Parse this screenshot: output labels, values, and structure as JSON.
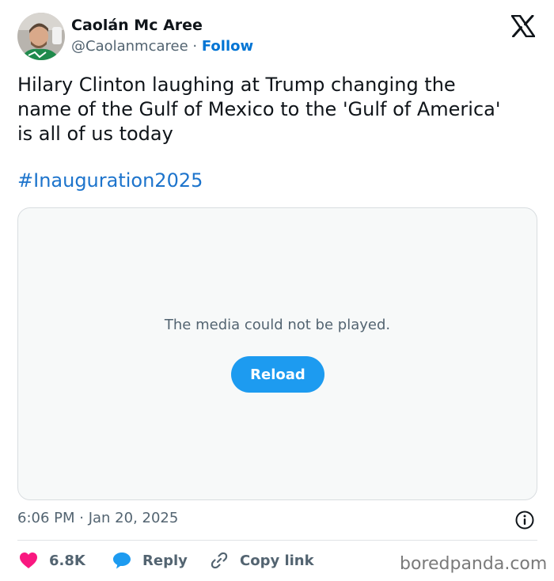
{
  "author": {
    "name": "Caolán Mc Aree",
    "handle": "@Caolanmcaree",
    "separator": " · ",
    "follow_label": "Follow"
  },
  "tweet": {
    "lines": [
      "Hilary Clinton laughing at Trump changing the",
      "name of the Gulf of Mexico to the 'Gulf of America'",
      "is all of us today"
    ],
    "hashtag": "#Inauguration2025"
  },
  "media": {
    "error_message": "The media could not be played.",
    "reload_label": "Reload"
  },
  "meta": {
    "timestamp": "6:06 PM · Jan 20, 2025"
  },
  "actions": {
    "likes": "6.8K",
    "reply_label": "Reply",
    "copy_link_label": "Copy link"
  },
  "watermark": "boredpanda.com",
  "icons": [
    "x-logo-icon",
    "info-icon",
    "heart-icon",
    "reply-bubble-icon",
    "link-icon"
  ],
  "colors": {
    "accent": "#1d9bf0",
    "link": "#0074d4",
    "heart": "#f91880",
    "secondary_text": "#536471"
  }
}
